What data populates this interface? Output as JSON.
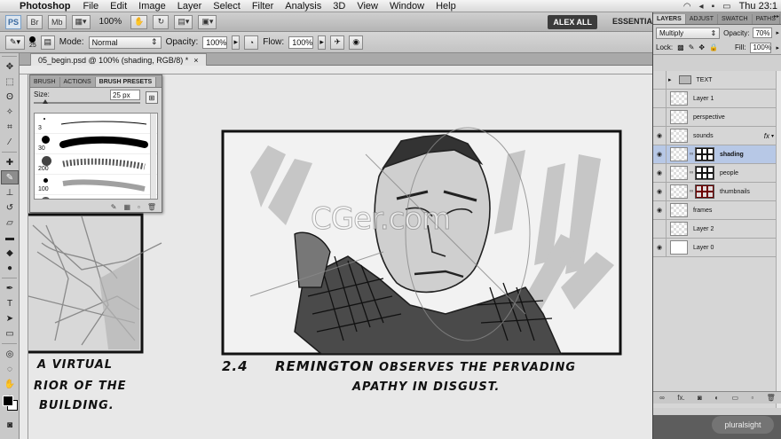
{
  "menubar": {
    "app_name": "Photoshop",
    "items": [
      "File",
      "Edit",
      "Image",
      "Layer",
      "Select",
      "Filter",
      "Analysis",
      "3D",
      "View",
      "Window",
      "Help"
    ],
    "clock": "Thu 23:1"
  },
  "appbar": {
    "logo": "PS",
    "br_label": "Br",
    "mb_label": "Mb",
    "zoom": "100%",
    "workspace_user": "ALEX ALL",
    "workspace": "ESSENTIA"
  },
  "options": {
    "brush_size": "25",
    "mode_label": "Mode:",
    "mode_value": "Normal",
    "opacity_label": "Opacity:",
    "opacity_value": "100%",
    "flow_label": "Flow:",
    "flow_value": "100%"
  },
  "document": {
    "tab_title": "05_begin.psd @ 100% (shading, RGB/8) *",
    "tab_close": "×"
  },
  "brush_panel": {
    "tabs": [
      "BRUSH",
      "ACTIONS",
      "BRUSH PRESETS"
    ],
    "active_tab": 2,
    "size_label": "Size:",
    "size_value": "25 px",
    "presets": [
      {
        "size": "3"
      },
      {
        "size": "30"
      },
      {
        "size": "200"
      },
      {
        "size": "100"
      },
      {
        "size": ""
      }
    ]
  },
  "canvas": {
    "captions": {
      "left_line1": "A VIRTUAL",
      "left_line2": "RIOR OF THE",
      "left_line3": "BUILDING.",
      "panel_number": "2.4",
      "main_bold": "REMINGTON",
      "main_rest": "OBSERVES THE PERVADING",
      "main_line2": "APATHY IN DISGUST."
    },
    "watermark": "CGer.com"
  },
  "layers_panel": {
    "tabs": [
      "LAYERS",
      "ADJUST",
      "SWATCH",
      "PATHS"
    ],
    "blend_mode": "Multiply",
    "opacity_label": "Opacity:",
    "opacity_value": "70%",
    "lock_label": "Lock:",
    "fill_label": "Fill:",
    "fill_value": "100%",
    "layers": [
      {
        "name": "TEXT",
        "type": "group",
        "visible": false
      },
      {
        "name": "Layer 1",
        "type": "layer",
        "visible": false
      },
      {
        "name": "perspective",
        "type": "layer",
        "visible": false
      },
      {
        "name": "sounds",
        "type": "layer",
        "visible": true,
        "fx": "fx"
      },
      {
        "name": "shading",
        "type": "masked",
        "visible": true,
        "selected": true
      },
      {
        "name": "people",
        "type": "masked",
        "visible": true
      },
      {
        "name": "thumbnails",
        "type": "masked-red",
        "visible": true
      },
      {
        "name": "frames",
        "type": "layer",
        "visible": true
      },
      {
        "name": "Layer 2",
        "type": "layer",
        "visible": false
      },
      {
        "name": "Layer 0",
        "type": "white",
        "visible": true
      }
    ]
  },
  "badge": "pluralsight",
  "colors": {
    "foreground": "#000000",
    "background": "#ffffff",
    "selected_layer": "#b7c8e6"
  }
}
